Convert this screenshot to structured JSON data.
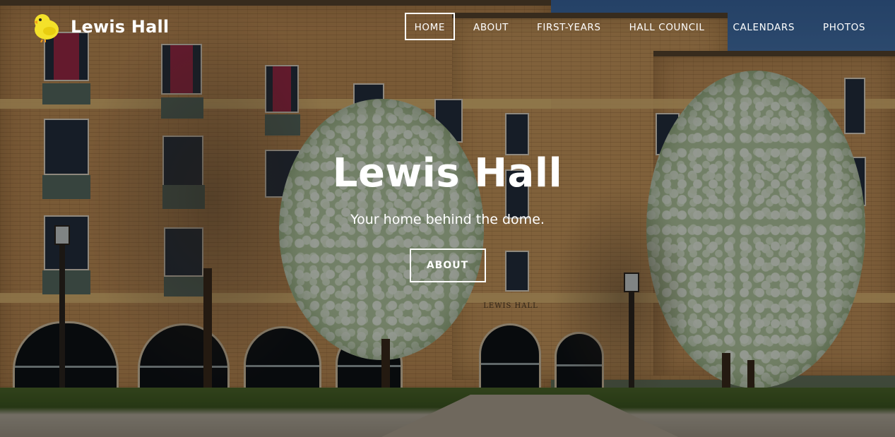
{
  "brand": {
    "name": "Lewis Hall",
    "logo_icon": "chick-icon",
    "logo_color": "#f4e12a"
  },
  "nav": {
    "items": [
      {
        "label": "HOME",
        "active": true
      },
      {
        "label": "ABOUT",
        "active": false
      },
      {
        "label": "FIRST-YEARS",
        "active": false
      },
      {
        "label": "HALL COUNCIL",
        "active": false
      },
      {
        "label": "CALENDARS",
        "active": false
      },
      {
        "label": "PHOTOS",
        "active": false
      }
    ]
  },
  "hero": {
    "title": "Lewis Hall",
    "subtitle": "Your home behind the dome.",
    "button_label": "ABOUT",
    "background_image": "Lewis Hall building exterior with flowering trees",
    "building_sign": "LEWIS HALL"
  },
  "colors": {
    "text": "#ffffff",
    "overlay": "rgba(0,0,0,0.38)"
  }
}
